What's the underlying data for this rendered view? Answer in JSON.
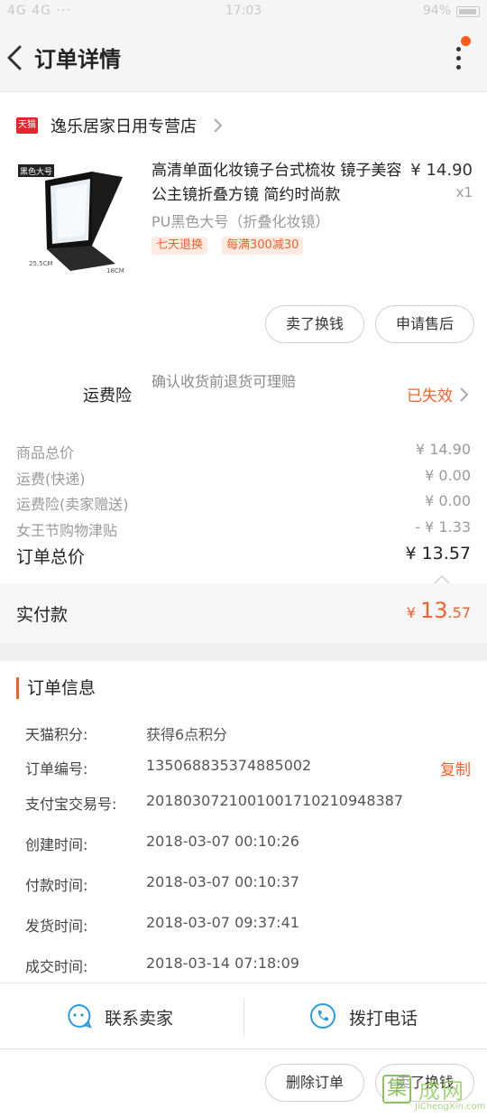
{
  "status_bar": {
    "left": "4G 4G ···",
    "time": "17:03",
    "right": "94%",
    "battery_level": 0.94
  },
  "header": {
    "title": "订单详情"
  },
  "shop": {
    "badge": "天猫",
    "name": "逸乐居家日用专营店"
  },
  "product": {
    "image_label": "黑色大号",
    "dim_left": "25.5CM",
    "dim_right": "18CM",
    "title": "高清单面化妆镜子台式梳妆 镜子美容公主镜折叠方镜 简约时尚款",
    "price": "¥ 14.90",
    "qty": "x1",
    "sku": "PU黑色大号（折叠化妆镜）",
    "tags": [
      "七天退换",
      "每满300减30"
    ],
    "buttons": {
      "sell_for_cash": "卖了换钱",
      "after_sales": "申请售后"
    }
  },
  "insurance": {
    "label": "运费险",
    "desc": "确认收货前退货可理赔",
    "status": "已失效"
  },
  "prices": {
    "lines": [
      {
        "label": "商品总价",
        "value": "¥ 14.90"
      },
      {
        "label": "运费(快递)",
        "value": "¥ 0.00"
      },
      {
        "label": "运费险(卖家赠送)",
        "value": "¥ 0.00"
      },
      {
        "label": "女王节购物津贴",
        "value": "- ¥ 1.33"
      }
    ],
    "total_label": "订单总价",
    "total_value": "¥ 13.57",
    "paid_label": "实付款",
    "paid_symbol": "¥ ",
    "paid_int": "13",
    "paid_dec": ".57"
  },
  "order_info": {
    "heading": "订单信息",
    "rows": [
      {
        "label": "天猫积分:",
        "value": "获得6点积分"
      },
      {
        "label": "订单编号:",
        "value": "135068835374885002",
        "action": "复制"
      },
      {
        "label": "支付宝交易号:",
        "value": "2018030721001001710210948387"
      },
      {
        "label": "创建时间:",
        "value": "2018-03-07 00:10:26"
      },
      {
        "label": "付款时间:",
        "value": "2018-03-07 00:10:37"
      },
      {
        "label": "发货时间:",
        "value": "2018-03-07 09:37:41"
      },
      {
        "label": "成交时间:",
        "value": "2018-03-14 07:18:09"
      }
    ]
  },
  "contact": {
    "seller": "联系卖家",
    "phone": "拨打电话"
  },
  "footer": {
    "delete": "删除订单",
    "sell_for_cash": "卖了换钱"
  },
  "watermark": {
    "box": "集",
    "text": "成网",
    "url": "JiChengXin.com"
  },
  "colors": {
    "accent": "#f0612d",
    "tmall_red": "#e8232b",
    "icon_blue": "#2b9be0"
  }
}
